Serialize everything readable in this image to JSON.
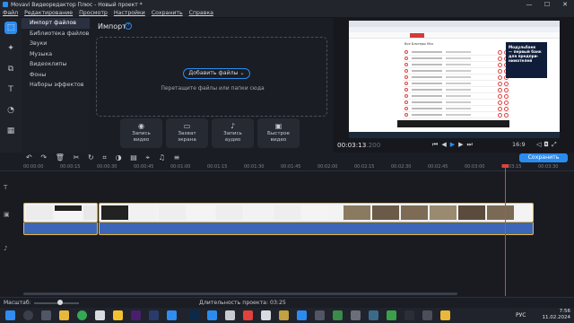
{
  "window": {
    "title": "Movavi Видеоредактор Плюс - Новый проект *",
    "controls": [
      "—",
      "☐",
      "✕"
    ]
  },
  "menu": [
    "Файл",
    "Редактирование",
    "Просмотр",
    "Настройки",
    "Сохранить",
    "Справка"
  ],
  "sidebar": {
    "items": [
      {
        "label": "Импорт файлов"
      },
      {
        "label": "Библиотека файлов"
      },
      {
        "label": "Звуки"
      },
      {
        "label": "Музыка"
      },
      {
        "label": "Видеоклипы"
      },
      {
        "label": "Фоны"
      },
      {
        "label": "Наборы эффектов"
      }
    ]
  },
  "import": {
    "title": "Импорт",
    "help": "?",
    "add_button": "Добавить файлы",
    "drop_text": "Перетащите файлы или папки сюда",
    "tiles": [
      {
        "line1": "Запись",
        "line2": "видео",
        "icon": "webcam-icon"
      },
      {
        "line1": "Захват",
        "line2": "экрана",
        "icon": "screen-icon"
      },
      {
        "line1": "Запись",
        "line2": "аудио",
        "icon": "mic-icon"
      },
      {
        "line1": "Быстрое",
        "line2": "видео",
        "icon": "wand-icon"
      }
    ]
  },
  "preview": {
    "page_heading": "Все Блогеры Мск",
    "ad_text": [
      "Модульбанк",
      "— первый банк",
      "для предпри-",
      "нимателей"
    ],
    "time_current": "00:03:13",
    "time_frac": ".200",
    "aspect": "16:9"
  },
  "toolbar": {
    "save_label": "Сохранить"
  },
  "ruler": [
    "00:00:00",
    "00:00:15",
    "00:00:30",
    "00:00:45",
    "00:01:00",
    "00:01:15",
    "00:01:30",
    "00:01:45",
    "00:02:00",
    "00:02:15",
    "00:02:30",
    "00:02:45",
    "00:03:00",
    "00:03:15",
    "00:03:30"
  ],
  "bottom": {
    "zoom_label": "Масштаб:",
    "duration_label": "Длительность проекта:",
    "duration_value": "03:25"
  },
  "tray": {
    "lang": "РУС",
    "time": "7:56",
    "date": "11.02.2024"
  }
}
